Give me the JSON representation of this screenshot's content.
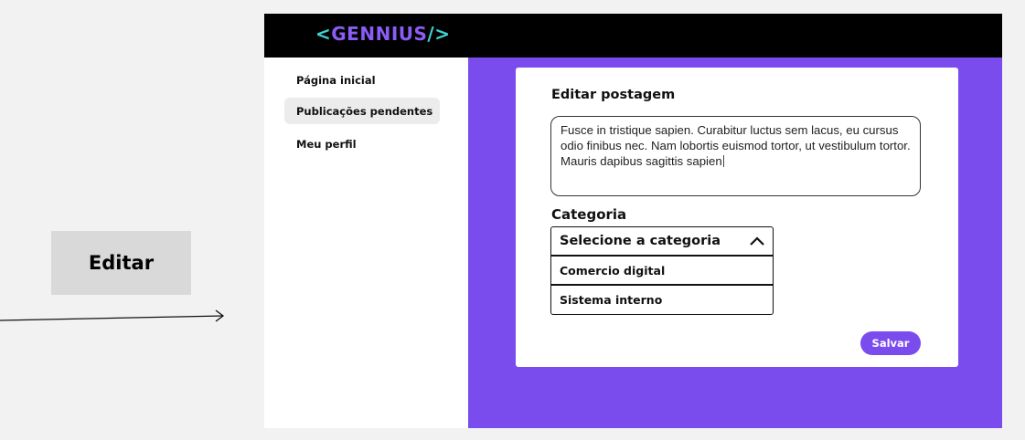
{
  "canvas": {
    "edit_label": "Editar"
  },
  "app": {
    "logo": {
      "open_bracket": "<",
      "word": "GENNIUS",
      "close_bracket": "/>"
    },
    "sidebar": {
      "items": [
        {
          "label": "Página inicial",
          "active": false
        },
        {
          "label": "Publicações pendentes",
          "active": true
        },
        {
          "label": "Meu perfil",
          "active": false
        }
      ]
    },
    "card": {
      "title": "Editar postagem",
      "textarea_value": "Fusce in tristique sapien. Curabitur luctus sem lacus, eu cursus odio finibus nec. Nam lobortis euismod tortor, ut vestibulum tortor. Mauris dapibus sagittis sapien",
      "category_label": "Categoria",
      "select": {
        "selected": "Selecione a categoria",
        "options": [
          "Comercio digital",
          "Sistema interno"
        ]
      },
      "save_label": "Salvar"
    }
  },
  "colors": {
    "accent_purple": "#7b4ced",
    "logo_bracket": "#3ed3d3",
    "logo_word": "#8b5cf6",
    "topbar": "#000000",
    "active_nav_bg": "#ececec"
  },
  "icons": {
    "select_chevron": "chevron-up-icon",
    "flow_arrow": "arrow-right-icon"
  }
}
